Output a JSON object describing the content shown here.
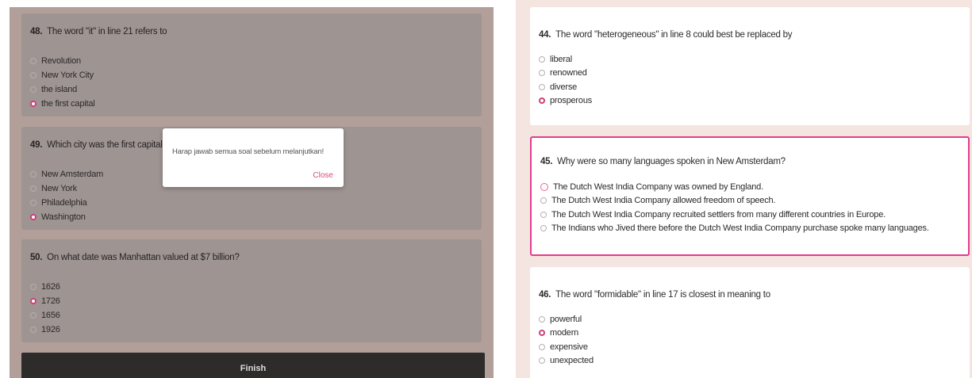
{
  "left": {
    "questions": [
      {
        "num": "48.",
        "text": "The word \"it\" in line 21 refers to",
        "options": [
          "Revolution",
          "New York City",
          "the island",
          "the first capital"
        ],
        "selected": 3
      },
      {
        "num": "49.",
        "text": "Which city was the first capital of the new United States?",
        "options": [
          "New Amsterdam",
          "New York",
          "Philadelphia",
          "Washington"
        ],
        "selected": 3
      },
      {
        "num": "50.",
        "text": "On what date was Manhattan valued at $7 billion?",
        "options": [
          "1626",
          "1726",
          "1656",
          "1926"
        ],
        "selected": 1
      }
    ],
    "finish_label": "Finish",
    "dialog": {
      "message": "Harap jawab semua soal sebelum melanjutkan!",
      "close_label": "Close"
    }
  },
  "right": {
    "questions": [
      {
        "num": "44.",
        "text": "The word \"heterogeneous\" in line 8 could best be replaced by",
        "options": [
          "liberal",
          "renowned",
          "diverse",
          "prosperous"
        ],
        "selected": 3
      },
      {
        "num": "45.",
        "text": "Why were so many languages spoken in New Amsterdam?",
        "options": [
          "The Dutch West India Company was owned by England.",
          "The Dutch West India Company allowed freedom of speech.",
          "The Dutch West India Company recruited settlers from many different countries in Europe.",
          "The Indians who Jived there before the Dutch West India Company purchase spoke many languages."
        ],
        "selected": null,
        "focused_option": 0,
        "highlighted": true
      },
      {
        "num": "46.",
        "text": "The word \"formidable\" in line 17 is closest in meaning to",
        "options": [
          "powerful",
          "modern",
          "expensive",
          "unexpected"
        ],
        "selected": 1
      }
    ]
  },
  "colors": {
    "accent": "#cf3f78",
    "highlight_border": "#e23c8d",
    "left_bg": "#b29f9a",
    "right_bg": "#f4e5e1"
  }
}
